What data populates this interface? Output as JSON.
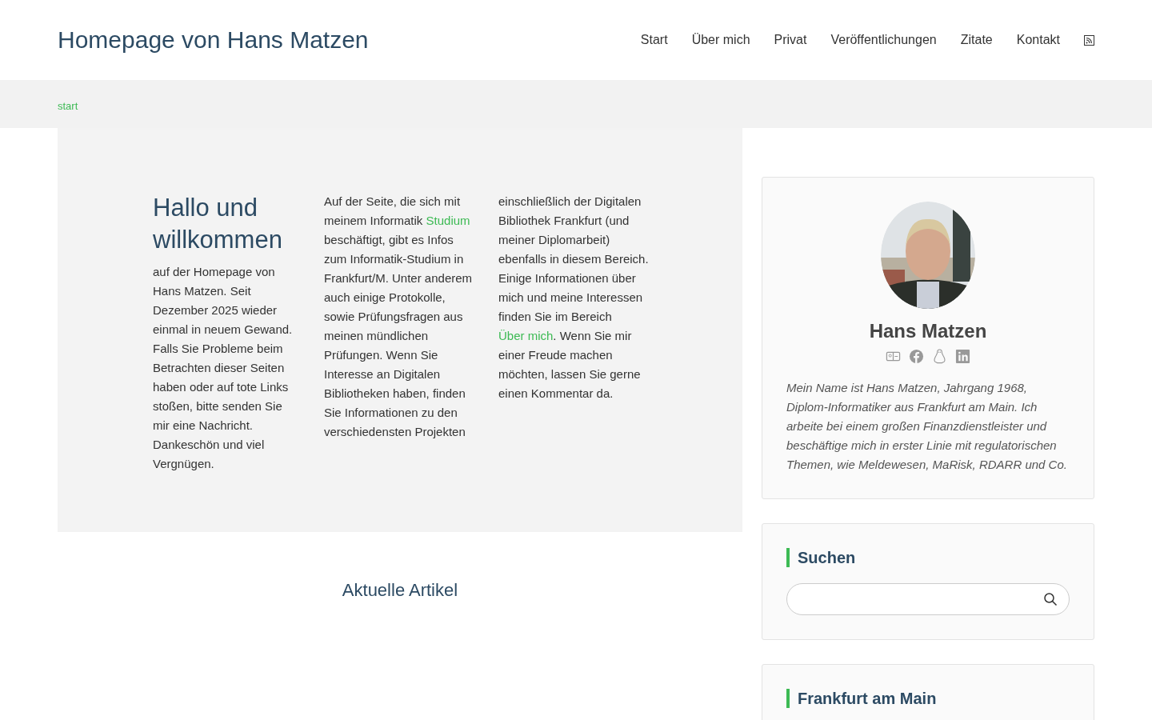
{
  "site_title": "Homepage von Hans Matzen",
  "nav": [
    {
      "label": "Start",
      "selected": false
    },
    {
      "label": "Über mich",
      "selected": false
    },
    {
      "label": "Privat",
      "selected": false
    },
    {
      "label": "Veröffentlichungen",
      "selected": false
    },
    {
      "label": "Zitate",
      "selected": false
    },
    {
      "label": "Kontakt",
      "selected": false
    }
  ],
  "breadcrumb": "start",
  "welcome": {
    "heading": "Hallo und willkommen",
    "columns": [
      [
        {
          "kind": "text",
          "text": "auf der Homepage von Hans Matzen. Seit Dezember 2025 wieder einmal in neuem Gewand. Falls Sie Probleme beim Betrachten dieser Seiten haben oder auf tote Links stoßen, bitte senden Sie mir eine Nachricht. Dankeschön und viel Vergnügen."
        }
      ],
      [
        {
          "kind": "text",
          "text": "Auf der Seite, die sich mit meinem Informatik "
        },
        {
          "kind": "link",
          "text": "Studium"
        },
        {
          "kind": "text",
          "text": " beschäftigt, gibt es Infos zum Informatik-Studium in Frankfurt/M. Unter anderem auch einige Protokolle, sowie Prüfungsfragen aus meinen mündlichen Prüfungen. Wenn Sie Interesse an Digitalen Bibliotheken haben, finden Sie Informationen zu den verschiedensten Projekten"
        }
      ],
      [
        {
          "kind": "text",
          "text": "einschließlich der Digitalen Bibliothek Frankfurt (und meiner Diplomarbeit) ebenfalls in diesem Bereich. Einige Informationen über mich und meine Interessen finden Sie im Bereich "
        },
        {
          "kind": "link",
          "text": "Über mich"
        },
        {
          "kind": "text",
          "text": ". Wenn Sie mir einer Freude machen möchten, lassen Sie gerne einen Kommentar da."
        }
      ]
    ]
  },
  "articles_heading": "Aktuelle Artikel",
  "profile": {
    "name": "Hans Matzen",
    "bio": "Mein Name ist Hans Matzen, Jahrgang 1968, Diplom-Informatiker aus Frankfurt am Main. Ich arbeite bei einem großen Finanzdienstleister und beschäftige mich in erster Linie mit regulatorischen Themen, wie Meldewesen, MaRisk, RDARR und Co."
  },
  "search": {
    "title": "Suchen"
  },
  "widget_3": {
    "title": "Frankfurt am Main"
  }
}
